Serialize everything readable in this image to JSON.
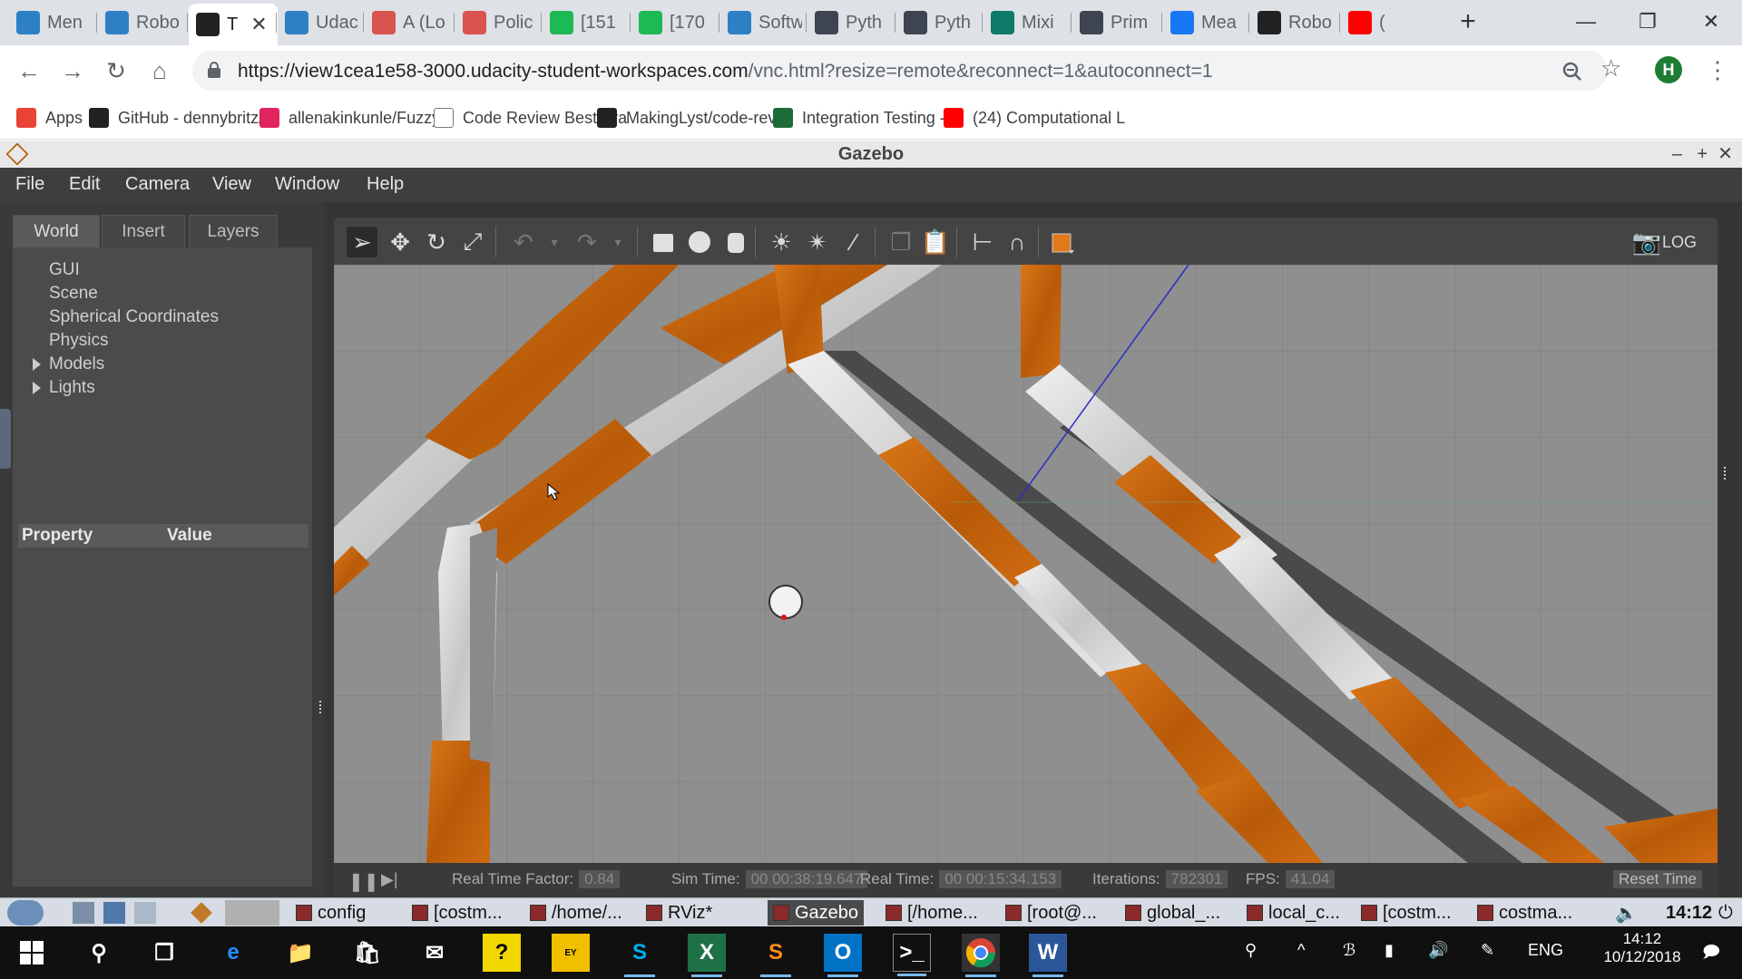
{
  "browser": {
    "tabs": [
      {
        "label": "Men",
        "icon": "udacity-icon",
        "color": "#2e80c4"
      },
      {
        "label": "Robo",
        "icon": "udacity-icon",
        "color": "#2e80c4"
      },
      {
        "label": "T",
        "icon": "vnc-icon",
        "color": "#222222",
        "active": true
      },
      {
        "label": "Udac",
        "icon": "udacity-icon",
        "color": "#2e80c4"
      },
      {
        "label": "A (Lo",
        "icon": "watermelon-icon",
        "color": "#d9534f"
      },
      {
        "label": "Polic",
        "icon": "watermelon-icon",
        "color": "#d9534f"
      },
      {
        "label": "[151",
        "icon": "smiley-icon",
        "color": "#1db954"
      },
      {
        "label": "[170",
        "icon": "smiley-icon",
        "color": "#1db954"
      },
      {
        "label": "Softw",
        "icon": "udacity-icon",
        "color": "#2e80c4"
      },
      {
        "label": "Pyth",
        "icon": "python-icon",
        "color": "#3e4450"
      },
      {
        "label": "Pyth",
        "icon": "python-icon",
        "color": "#3e4450"
      },
      {
        "label": "Mixi",
        "icon": "terminal-icon",
        "color": "#0d7a6a"
      },
      {
        "label": "Prim",
        "icon": "python-icon",
        "color": "#3e4450"
      },
      {
        "label": "Mea",
        "icon": "meta-icon",
        "color": "#1877f2"
      },
      {
        "label": "Robo",
        "icon": "github-icon",
        "color": "#222222"
      },
      {
        "label": "(",
        "icon": "youtube-icon",
        "color": "#ff0000"
      }
    ],
    "tab_close": "✕",
    "new_tab": "+",
    "url_host": "https://view1cea1e58-3000.udacity-student-workspaces.com",
    "url_rest": "/vnc.html?resize=remote&reconnect=1&autoconnect=1",
    "avatar_letter": "H",
    "bookmarks": [
      {
        "label": "Apps",
        "icon": "apps-icon",
        "color": "#ea4335"
      },
      {
        "label": "GitHub - dennybritz/",
        "icon": "github-icon",
        "color": "#222222"
      },
      {
        "label": "allenakinkunle/Fuzzy",
        "icon": "gear-icon",
        "color": "#e0245e"
      },
      {
        "label": "Code Review Best Pra",
        "icon": "document-icon",
        "color": "#ffffff"
      },
      {
        "label": "MakingLyst/code-rev",
        "icon": "github-icon",
        "color": "#222222"
      },
      {
        "label": "Integration Testing -",
        "icon": "grid-icon",
        "color": "#1e6b3a"
      },
      {
        "label": "(24) Computational L",
        "icon": "youtube-icon",
        "color": "#ff0000"
      }
    ]
  },
  "gazebo": {
    "title": "Gazebo",
    "menus": [
      "File",
      "Edit",
      "Camera",
      "View",
      "Window",
      "Help"
    ],
    "tabs": [
      "World",
      "Insert",
      "Layers"
    ],
    "tree": [
      {
        "label": "GUI",
        "expandable": false
      },
      {
        "label": "Scene",
        "expandable": false
      },
      {
        "label": "Spherical Coordinates",
        "expandable": false
      },
      {
        "label": "Physics",
        "expandable": false
      },
      {
        "label": "Models",
        "expandable": true
      },
      {
        "label": "Lights",
        "expandable": true
      }
    ],
    "property_header": "Property",
    "value_header": "Value",
    "status": {
      "real_time_factor_label": "Real Time Factor:",
      "real_time_factor": "0.84",
      "sim_time_label": "Sim Time:",
      "sim_time": "00 00:38:19.647",
      "real_time_label": "Real Time:",
      "real_time": "00 00:15:34.153",
      "iterations_label": "Iterations:",
      "iterations": "782301",
      "fps_label": "FPS:",
      "fps": "41.04",
      "reset_label": "Reset Time"
    }
  },
  "vnc_taskbar": {
    "items": [
      "config",
      "[costm...",
      "/home/...",
      "RViz*",
      "Gazebo",
      "[/home...",
      "[root@...",
      "global_...",
      "local_c...",
      "[costm...",
      "costma..."
    ],
    "active_index": 4,
    "clock": "14:12"
  },
  "windows_taskbar": {
    "language": "ENG",
    "time": "14:12",
    "date": "10/12/2018"
  },
  "colors": {
    "wood": "#c8650f",
    "wall_white": "#d8d8d8",
    "ground": "#8f8f8f",
    "shadow": "#4d4d4d"
  }
}
